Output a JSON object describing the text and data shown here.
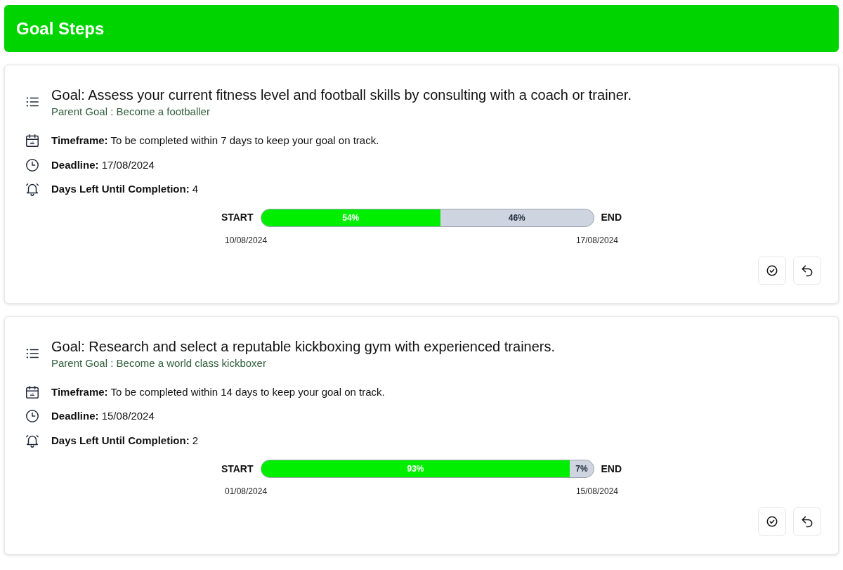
{
  "header": {
    "title": "Goal Steps"
  },
  "steps": [
    {
      "goal": "Goal: Assess your current fitness level and football skills by consulting with a coach or trainer.",
      "parent": "Parent Goal : Become a footballer",
      "timeframe": "**Timeframe:** To be completed within 7 days to keep your goal on track.",
      "deadline": "**Deadline:** 17/08/2024",
      "days_left": "**Days Left Until Completion:** 4",
      "progress": {
        "start_label": "START",
        "end_label": "END",
        "level": 0.54,
        "done_text": "54%",
        "remaining_text": "46%",
        "start_date": "10/08/2024",
        "end_date": "17/08/2024"
      }
    },
    {
      "goal": "Goal: Research and select a reputable kickboxing gym with experienced trainers.",
      "parent": "Parent Goal : Become a world class kickboxer",
      "timeframe": "**Timeframe:** To be completed within 14 days to keep your goal on track.",
      "deadline": "**Deadline:** 15/08/2024",
      "days_left": "**Days Left Until Completion:** 2",
      "progress": {
        "start_label": "START",
        "end_label": "END",
        "level": 0.93,
        "done_text": "93%",
        "remaining_text": "7%",
        "start_date": "01/08/2024",
        "end_date": "15/08/2024"
      }
    }
  ]
}
